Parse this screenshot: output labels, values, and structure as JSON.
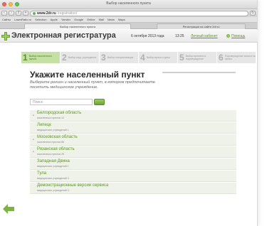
{
  "browser": {
    "window_title": "Выбор населенного пункта",
    "url_host": "www.2dr.ru",
    "url_path": "/registration/",
    "bookmarks": [
      "Сайты",
      "LaserRatio.ru",
      "Selection",
      "Apple",
      "Yandex",
      "Google",
      "Online",
      "Mail",
      "News",
      "Maps"
    ],
    "tabs": [
      {
        "label": "Выбор населенного пункта",
        "active": true
      },
      {
        "label": "Регистрация на сайте 2dr.ru",
        "active": false
      }
    ]
  },
  "header": {
    "title": "Электронная регистратура",
    "date": "6 октября 2013 года",
    "time": "13:25",
    "cabinet": "Личный кабинет",
    "help": "Помощь"
  },
  "steps": [
    {
      "num": "1",
      "label": "Выбор населенного пункта",
      "active": true
    },
    {
      "num": "2",
      "label": "Выбор мед. учреждения",
      "active": false
    },
    {
      "num": "3",
      "label": "Выбор специализации",
      "active": false
    },
    {
      "num": "4",
      "label": "Выбор врача и даты",
      "active": false
    },
    {
      "num": "5",
      "label": "Выбор времени и подтверждение",
      "active": false
    },
    {
      "num": "6",
      "label": "Подтверждение записи на прием",
      "active": false
    }
  ],
  "content": {
    "title": "Укажите населенный пункт",
    "subtitle": "Выберите регион и населенный пункт, в котором предпочитаете посетить медицинское учреждение.",
    "search_placeholder": "Поиск"
  },
  "regions": [
    {
      "name": "Белгородская область",
      "count": "населенных пунктов 12",
      "bullet": true
    },
    {
      "name": "Липецк",
      "count": "медицинских учреждений 1",
      "bullet": false
    },
    {
      "name": "Московская область",
      "count": "населенных пунктов 88",
      "bullet": true
    },
    {
      "name": "Рязанская область",
      "count": "населенных пунктов 25",
      "bullet": true
    },
    {
      "name": "Западная Двина",
      "count": "медицинских учреждений 1",
      "bullet": false
    },
    {
      "name": "Тула",
      "count": "медицинских учреждений 3",
      "bullet": false
    },
    {
      "name": "Демонстрационные версии сервиса",
      "count": "медицинских учреждений 3",
      "bullet": false
    }
  ],
  "colors": {
    "accent": "#5a9a1a",
    "active_step": "#c5e0a5"
  }
}
